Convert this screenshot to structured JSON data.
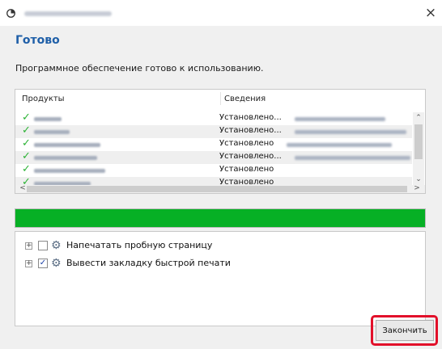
{
  "window": {
    "close_glyph": "×",
    "app_icon": "installer-disc-icon"
  },
  "main": {
    "heading": "Готово",
    "description": "Программное обеспечение готово к использованию."
  },
  "products": {
    "columns": [
      "Продукты",
      "Сведения"
    ],
    "rows": [
      {
        "status": "Установлено..."
      },
      {
        "status": "Установлено..."
      },
      {
        "status": "Установлено"
      },
      {
        "status": "Установлено..."
      },
      {
        "status": "Установлено"
      },
      {
        "status": "Установлено"
      }
    ],
    "check_icon": "checkmark-icon",
    "check_color": "#2db336"
  },
  "progress": {
    "value_percent": 100,
    "color": "#06b025"
  },
  "options": [
    {
      "label": "Напечатать пробную страницу",
      "checked": false,
      "icon": "gear-icon"
    },
    {
      "label": "Вывести закладку быстрой печати",
      "checked": true,
      "icon": "gear-icon"
    }
  ],
  "footer": {
    "finish_label": "Закончить",
    "highlight_color": "#e2102a"
  },
  "colors": {
    "heading": "#1f5fa8",
    "background": "#f0f0f0"
  }
}
